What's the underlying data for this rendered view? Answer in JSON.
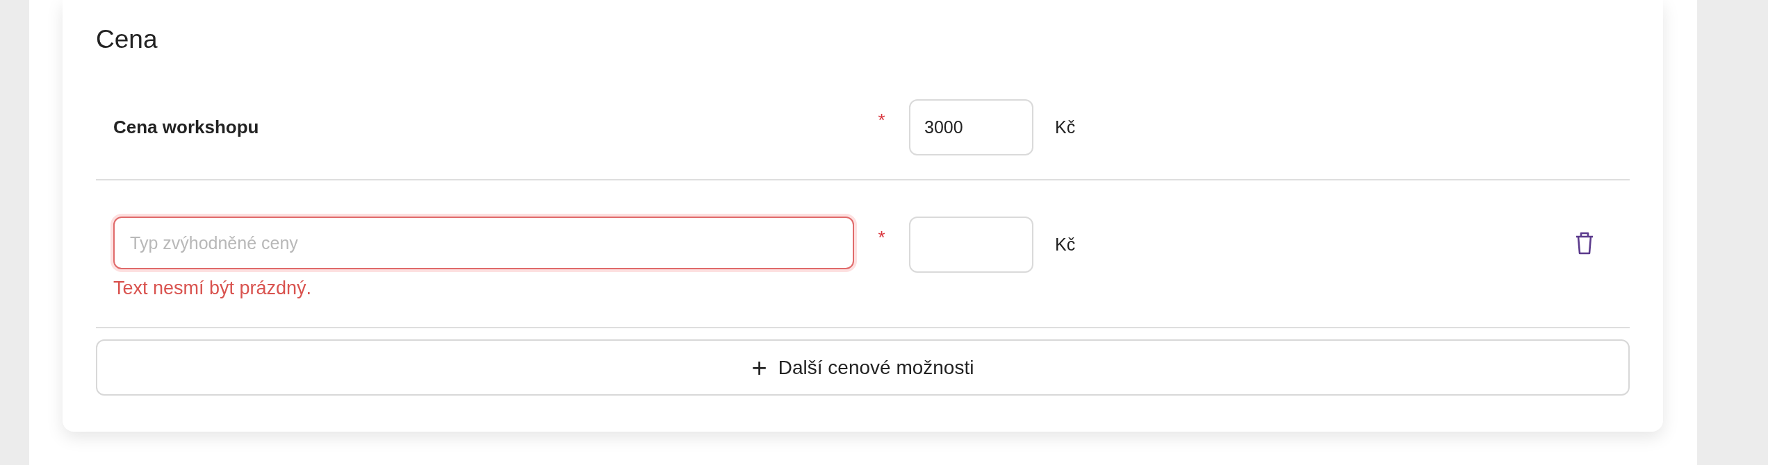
{
  "section": {
    "title": "Cena"
  },
  "price_rows": [
    {
      "kind": "fixed",
      "label": "Cena workshopu",
      "required_mark": "*",
      "amount": "3000",
      "currency": "Kč"
    },
    {
      "kind": "custom",
      "placeholder": "Typ zvýhodněné ceny",
      "invalid": true,
      "error": "Text nesmí být prázdný.",
      "required_mark": "*",
      "currency": "Kč"
    }
  ],
  "add_button": {
    "icon": "+",
    "label": "Další cenové možnosti"
  }
}
